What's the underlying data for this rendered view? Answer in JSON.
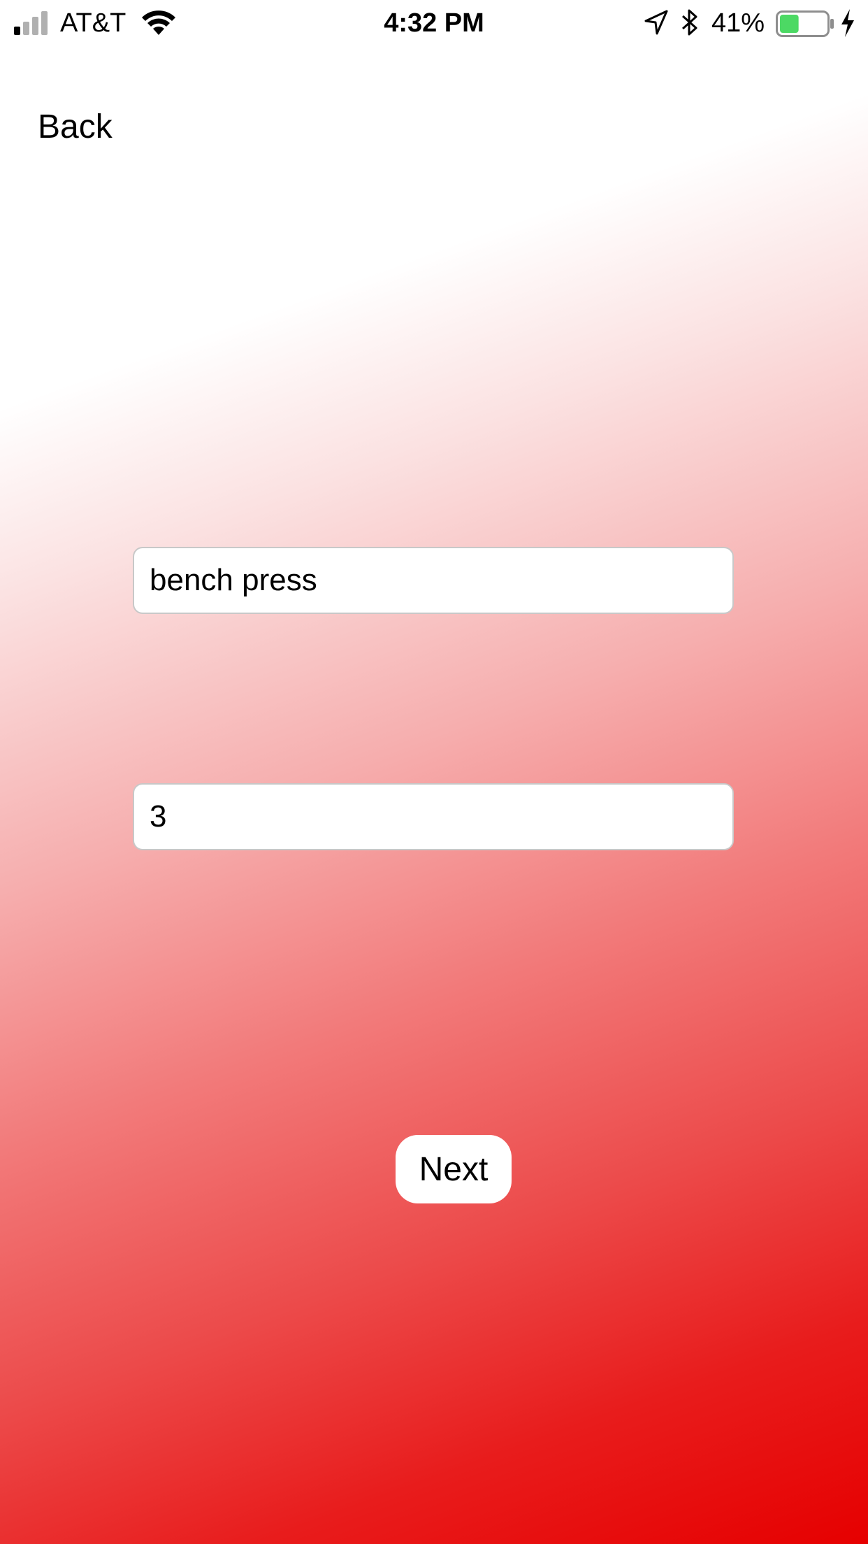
{
  "status_bar": {
    "carrier": "AT&T",
    "time": "4:32 PM",
    "battery_percent": "41%",
    "battery_level": 0.41,
    "battery_color": "#4cd964",
    "icons": [
      "signal-icon",
      "wifi-icon",
      "location-icon",
      "bluetooth-icon",
      "battery-icon",
      "charging-icon"
    ]
  },
  "nav": {
    "back_label": "Back"
  },
  "form": {
    "exercise_value": "bench press",
    "sets_value": "3",
    "next_label": "Next"
  },
  "theme": {
    "gradient_start": "#ffffff",
    "gradient_end": "#e60000"
  }
}
